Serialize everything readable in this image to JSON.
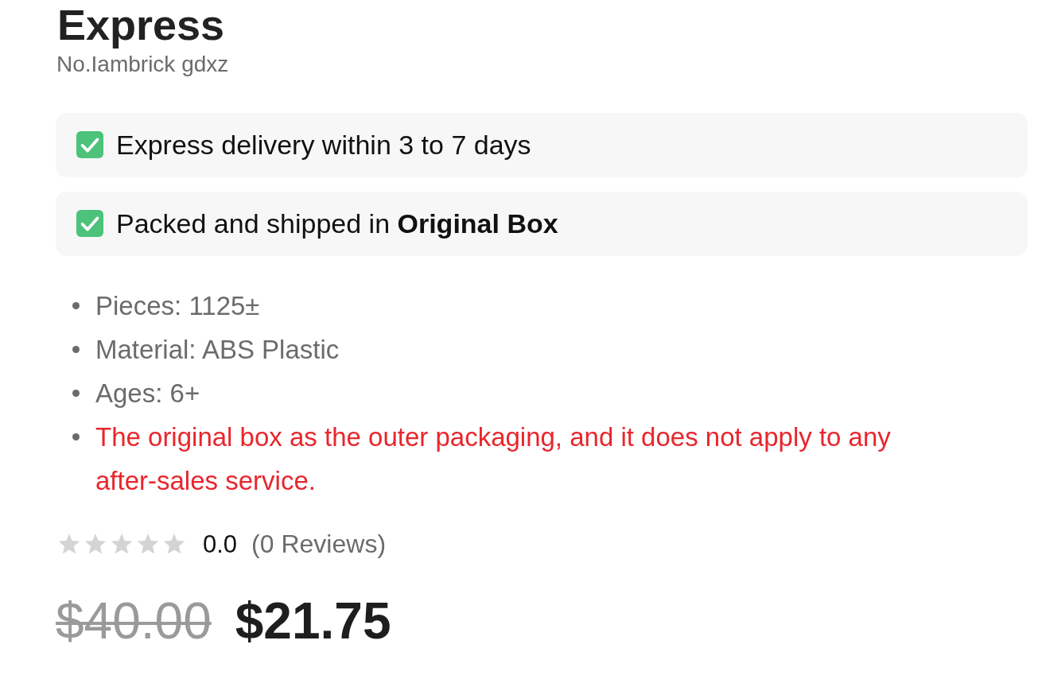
{
  "product": {
    "title": "Express",
    "code": "No.Iambrick gdxz"
  },
  "features": [
    {
      "text": "Express delivery within 3 to 7 days"
    },
    {
      "text": "Packed and shipped in **Original Box**"
    }
  ],
  "specs": [
    {
      "kind": "spec",
      "text": "Pieces: 1125±"
    },
    {
      "kind": "spec",
      "text": "Material: ABS Plastic"
    },
    {
      "kind": "spec",
      "text": "Ages: 6+"
    },
    {
      "kind": "notice",
      "text": "The original box as the outer packaging, and it does not apply to any after-sales service."
    }
  ],
  "rating": {
    "stars": 0,
    "score": "0.0",
    "reviews": "(0 Reviews)"
  },
  "price": {
    "original": "$40.00",
    "sale": "$21.75"
  }
}
